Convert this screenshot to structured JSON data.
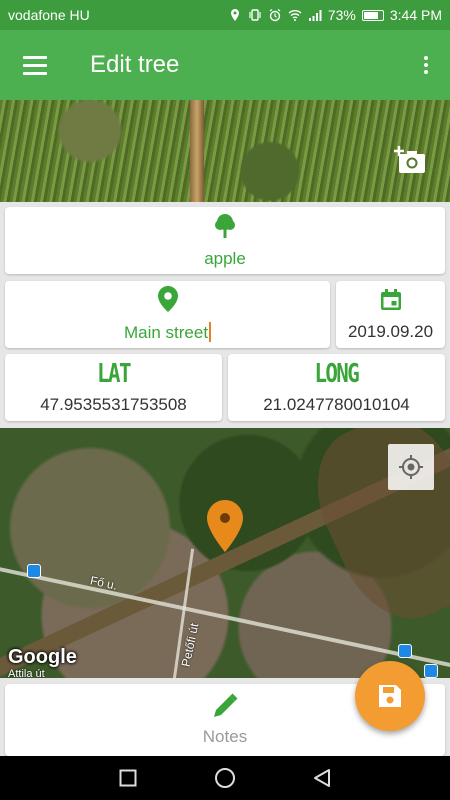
{
  "status_bar": {
    "carrier": "vodafone HU",
    "battery": "73%",
    "time": "3:44 PM"
  },
  "app_bar": {
    "title": "Edit tree"
  },
  "tree": {
    "name": "apple"
  },
  "address": {
    "value": "Main street"
  },
  "date": {
    "value": "2019.09.20"
  },
  "lat": {
    "label": "LAT",
    "value": "47.9535531753508"
  },
  "long": {
    "label": "LONG",
    "value": "21.0247780010104"
  },
  "map": {
    "street1": "Fő u.",
    "street2": "Petőfi út",
    "street3": "Attila út",
    "logo": "Google"
  },
  "notes": {
    "label": "Notes"
  },
  "colors": {
    "primary": "#4caf50",
    "primary_dark": "#3d9c3d",
    "accent": "#f39c32",
    "text_green": "#3aa63a"
  },
  "icons": [
    "menu-icon",
    "more-vert-icon",
    "add-photo-icon",
    "tree-icon",
    "location-pin-icon",
    "calendar-icon",
    "my-location-icon",
    "map-marker-icon",
    "pencil-icon",
    "save-icon",
    "recent-apps-icon",
    "home-icon",
    "back-icon"
  ]
}
